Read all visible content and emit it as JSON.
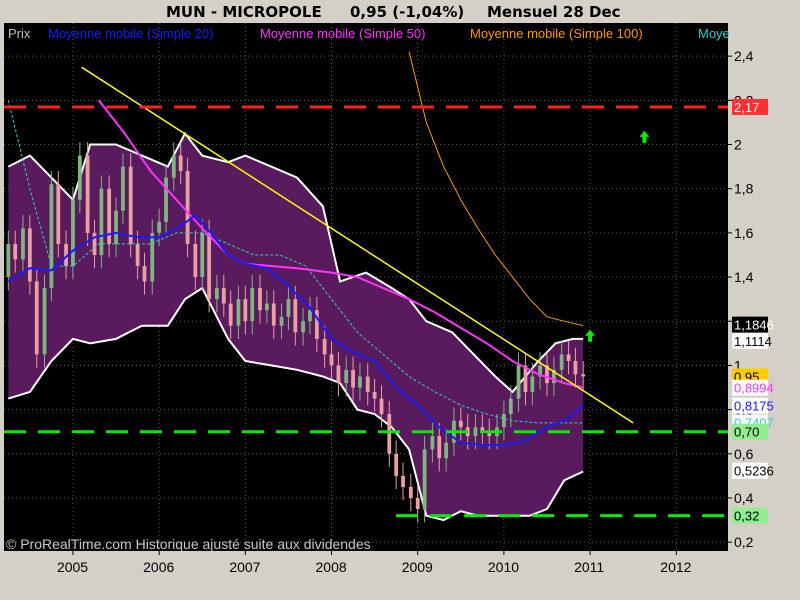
{
  "header": {
    "symbol": "MUN - MICROPOLE",
    "quote": "0,95 (-1,04%)",
    "period": "Mensuel  28 Dec"
  },
  "legend": {
    "items": [
      {
        "label": "Prix",
        "color": "#c0c0c0"
      },
      {
        "label": "Moyenne mobile (Simple 20)",
        "color": "#1a1aff"
      },
      {
        "label": "Moyenne mobile (Simple 50)",
        "color": "#ff33ff"
      },
      {
        "label": "Moyenne mobile (Simple 100)",
        "color": "#ff9900"
      },
      {
        "label": "Moye",
        "color": "#33cccc"
      }
    ]
  },
  "footer": "© ProRealTime.com Historique ajusté suite aux dividendes",
  "colors": {
    "background": "#000000",
    "frame": "#d4d0c8",
    "bollinger_fill": "#5a1a5e",
    "bollinger_edge": "#ffffff",
    "candle_up": "#7fb67f",
    "candle_down": "#e8a0a0",
    "ma20": "#1a1aff",
    "ma50": "#ff33ff",
    "ma100": "#ff9900",
    "bollinger_mid": "#33cccc",
    "trendline": "#ffff00",
    "resistance": "#ff2020",
    "support": "#00ee00",
    "arrow": "#00ee00"
  },
  "price_labels": [
    {
      "text": "2,17",
      "value": 2.17,
      "bg": "#ff3030",
      "fg": "#ffffff"
    },
    {
      "text": "1,1846",
      "value": 1.1846,
      "bg": "#000000",
      "fg": "#ffffff"
    },
    {
      "text": "1,1114",
      "value": 1.1114,
      "bg": "#ffffff",
      "fg": "#000000"
    },
    {
      "text": "0,95",
      "value": 0.95,
      "bg": "#ffcc00",
      "fg": "#000000"
    },
    {
      "text": "0,8994",
      "value": 0.8994,
      "bg": "#ffffff",
      "fg": "#ff33ff"
    },
    {
      "text": "0,8175",
      "value": 0.8175,
      "bg": "#ffffff",
      "fg": "#1a1aff"
    },
    {
      "text": "0,7407",
      "value": 0.7407,
      "bg": "#ffffff",
      "fg": "#33cccc"
    },
    {
      "text": "0,70",
      "value": 0.7,
      "bg": "#90ee90",
      "fg": "#000000"
    },
    {
      "text": "0,5236",
      "value": 0.5236,
      "bg": "#ffffff",
      "fg": "#000000"
    },
    {
      "text": "0,32",
      "value": 0.32,
      "bg": "#90ee90",
      "fg": "#000000"
    }
  ],
  "chart_data": {
    "type": "line",
    "title": "MUN - MICROPOLE",
    "x_ticks": [
      "2005",
      "2006",
      "2007",
      "2008",
      "2009",
      "2010",
      "2011",
      "2012"
    ],
    "y_ticks": [
      "0,2",
      "0,4",
      "0,6",
      "0,8",
      "1",
      "1,2",
      "1,4",
      "1,6",
      "1,8",
      "2",
      "2,2",
      "2,4"
    ],
    "y_tick_values": [
      0.2,
      0.4,
      0.6,
      0.8,
      1.0,
      1.2,
      1.4,
      1.6,
      1.8,
      2.0,
      2.2,
      2.4
    ],
    "xlim": [
      2004.2,
      2012.6
    ],
    "ylim": [
      0.16,
      2.55
    ],
    "series": [
      {
        "name": "Prix",
        "kind": "candlestick",
        "x": [
          2004.25,
          2004.33,
          2004.42,
          2004.5,
          2004.58,
          2004.67,
          2004.75,
          2004.83,
          2004.92,
          2005.0,
          2005.08,
          2005.17,
          2005.25,
          2005.33,
          2005.42,
          2005.5,
          2005.58,
          2005.67,
          2005.75,
          2005.83,
          2005.92,
          2006.0,
          2006.08,
          2006.17,
          2006.25,
          2006.33,
          2006.42,
          2006.5,
          2006.58,
          2006.67,
          2006.75,
          2006.83,
          2006.92,
          2007.0,
          2007.08,
          2007.17,
          2007.25,
          2007.33,
          2007.42,
          2007.5,
          2007.58,
          2007.67,
          2007.75,
          2007.83,
          2007.92,
          2008.0,
          2008.08,
          2008.17,
          2008.25,
          2008.33,
          2008.42,
          2008.5,
          2008.58,
          2008.67,
          2008.75,
          2008.83,
          2008.92,
          2009.0,
          2009.08,
          2009.17,
          2009.25,
          2009.33,
          2009.42,
          2009.5,
          2009.58,
          2009.67,
          2009.75,
          2009.83,
          2009.92,
          2010.0,
          2010.08,
          2010.17,
          2010.25,
          2010.33,
          2010.42,
          2010.5,
          2010.58,
          2010.67,
          2010.75,
          2010.83,
          2010.92
        ],
        "close": [
          1.55,
          1.48,
          1.62,
          1.38,
          1.05,
          1.35,
          1.82,
          1.55,
          1.45,
          1.75,
          1.95,
          1.6,
          1.5,
          1.8,
          1.55,
          1.7,
          1.9,
          1.55,
          1.45,
          1.38,
          1.6,
          1.65,
          1.85,
          1.95,
          1.88,
          1.55,
          1.4,
          1.6,
          1.3,
          1.35,
          1.28,
          1.18,
          1.3,
          1.2,
          1.35,
          1.25,
          1.28,
          1.18,
          1.22,
          1.3,
          1.15,
          1.2,
          1.25,
          1.12,
          1.05,
          1.0,
          0.92,
          0.98,
          0.9,
          0.95,
          0.88,
          0.85,
          0.78,
          0.6,
          0.5,
          0.45,
          0.4,
          0.35,
          0.62,
          0.68,
          0.58,
          0.65,
          0.75,
          0.72,
          0.68,
          0.72,
          0.7,
          0.68,
          0.72,
          0.78,
          0.85,
          1.0,
          0.88,
          0.95,
          1.0,
          0.92,
          0.98,
          1.05,
          1.02,
          0.96,
          0.95
        ],
        "open": [
          1.4,
          1.55,
          1.48,
          1.62,
          1.38,
          1.05,
          1.35,
          1.82,
          1.55,
          1.45,
          1.75,
          1.95,
          1.6,
          1.5,
          1.8,
          1.55,
          1.7,
          1.9,
          1.55,
          1.45,
          1.38,
          1.6,
          1.65,
          1.85,
          1.95,
          1.88,
          1.55,
          1.4,
          1.6,
          1.3,
          1.35,
          1.28,
          1.18,
          1.3,
          1.2,
          1.35,
          1.25,
          1.28,
          1.18,
          1.22,
          1.3,
          1.15,
          1.2,
          1.25,
          1.12,
          1.05,
          1.0,
          0.92,
          0.98,
          0.9,
          0.95,
          0.88,
          0.85,
          0.78,
          0.6,
          0.5,
          0.45,
          0.4,
          0.35,
          0.62,
          0.68,
          0.58,
          0.65,
          0.75,
          0.72,
          0.68,
          0.72,
          0.7,
          0.68,
          0.72,
          0.78,
          0.85,
          1.0,
          0.88,
          0.95,
          1.0,
          0.92,
          0.98,
          1.05,
          1.02,
          0.96
        ]
      },
      {
        "name": "Moyenne mobile (Simple 20)",
        "x": [
          2004.25,
          2004.5,
          2004.75,
          2005.0,
          2005.25,
          2005.5,
          2005.75,
          2006.0,
          2006.25,
          2006.42,
          2006.6,
          2006.8,
          2007.0,
          2007.25,
          2007.5,
          2007.75,
          2008.0,
          2008.25,
          2008.5,
          2008.75,
          2009.0,
          2009.25,
          2009.5,
          2009.75,
          2010.0,
          2010.25,
          2010.5,
          2010.75,
          2010.92
        ],
        "values": [
          1.38,
          1.44,
          1.43,
          1.52,
          1.58,
          1.6,
          1.58,
          1.58,
          1.63,
          1.68,
          1.6,
          1.5,
          1.46,
          1.44,
          1.36,
          1.26,
          1.12,
          1.06,
          1.02,
          0.9,
          0.82,
          0.72,
          0.65,
          0.64,
          0.64,
          0.66,
          0.72,
          0.76,
          0.82
        ]
      },
      {
        "name": "Moyenne mobile (Simple 50)",
        "x": [
          2005.3,
          2005.6,
          2005.9,
          2006.2,
          2006.5,
          2006.8,
          2007.0,
          2007.3,
          2007.6,
          2008.0,
          2008.3,
          2008.6,
          2008.9,
          2009.2,
          2009.5,
          2009.8,
          2010.1,
          2010.4,
          2010.7,
          2010.92
        ],
        "values": [
          2.2,
          2.05,
          1.88,
          1.75,
          1.62,
          1.5,
          1.46,
          1.45,
          1.44,
          1.42,
          1.4,
          1.35,
          1.3,
          1.24,
          1.17,
          1.1,
          1.02,
          0.96,
          0.92,
          0.9
        ]
      },
      {
        "name": "Moyenne mobile (Simple 100)",
        "x": [
          2008.9,
          2009.1,
          2009.3,
          2009.5,
          2009.7,
          2009.9,
          2010.1,
          2010.3,
          2010.5,
          2010.7,
          2010.92
        ],
        "values": [
          2.42,
          2.1,
          1.9,
          1.75,
          1.62,
          1.5,
          1.4,
          1.3,
          1.22,
          1.2,
          1.18
        ]
      },
      {
        "name": "Moye",
        "x": [
          2004.25,
          2004.5,
          2004.75,
          2005.0,
          2005.3,
          2005.6,
          2005.9,
          2006.2,
          2006.5,
          2006.8,
          2007.1,
          2007.4,
          2007.7,
          2008.0,
          2008.3,
          2008.6,
          2008.9,
          2009.2,
          2009.5,
          2009.8,
          2010.1,
          2010.4,
          2010.7,
          2010.92
        ],
        "values": [
          2.2,
          1.8,
          1.45,
          1.45,
          1.55,
          1.55,
          1.55,
          1.6,
          1.6,
          1.55,
          1.5,
          1.5,
          1.45,
          1.3,
          1.15,
          1.05,
          0.95,
          0.88,
          0.82,
          0.78,
          0.75,
          0.74,
          0.74,
          0.74
        ]
      },
      {
        "name": "bollinger_upper",
        "x": [
          2004.25,
          2004.5,
          2004.75,
          2005.0,
          2005.2,
          2005.5,
          2005.8,
          2006.1,
          2006.3,
          2006.5,
          2006.8,
          2007.0,
          2007.3,
          2007.6,
          2007.9,
          2008.1,
          2008.4,
          2008.7,
          2008.9,
          2009.1,
          2009.4,
          2009.7,
          2009.9,
          2010.1,
          2010.4,
          2010.6,
          2010.8,
          2010.92
        ],
        "values": [
          1.9,
          1.95,
          1.85,
          1.75,
          2.0,
          2.0,
          1.95,
          1.9,
          2.05,
          1.95,
          1.92,
          1.95,
          1.9,
          1.85,
          1.72,
          1.38,
          1.42,
          1.35,
          1.3,
          1.2,
          1.15,
          1.03,
          0.95,
          0.88,
          1.02,
          1.1,
          1.12,
          1.12
        ]
      },
      {
        "name": "bollinger_lower",
        "x": [
          2004.25,
          2004.5,
          2004.75,
          2005.0,
          2005.2,
          2005.5,
          2005.8,
          2006.1,
          2006.3,
          2006.5,
          2006.8,
          2007.0,
          2007.3,
          2007.6,
          2007.9,
          2008.1,
          2008.3,
          2008.5,
          2008.7,
          2008.9,
          2009.1,
          2009.3,
          2009.5,
          2009.7,
          2009.9,
          2010.1,
          2010.3,
          2010.5,
          2010.7,
          2010.92
        ],
        "values": [
          0.85,
          0.88,
          1.02,
          1.12,
          1.1,
          1.12,
          1.18,
          1.18,
          1.3,
          1.35,
          1.12,
          1.02,
          1.0,
          0.98,
          0.95,
          0.92,
          0.8,
          0.78,
          0.72,
          0.62,
          0.32,
          0.3,
          0.34,
          0.32,
          0.32,
          0.32,
          0.32,
          0.35,
          0.48,
          0.52
        ]
      }
    ],
    "trendline": {
      "x": [
        2005.1,
        2011.5
      ],
      "y": [
        2.35,
        0.74
      ]
    },
    "lines": [
      {
        "name": "resistance",
        "value": 2.17,
        "x_start": 2004.2
      },
      {
        "name": "support_1",
        "value": 0.7,
        "x_start": 2004.2
      },
      {
        "name": "support_2",
        "value": 0.32,
        "x_start": 2008.75
      }
    ],
    "arrows": [
      {
        "x": 2011.63,
        "value": 2.03
      },
      {
        "x": 2011.0,
        "value": 1.13
      }
    ]
  }
}
